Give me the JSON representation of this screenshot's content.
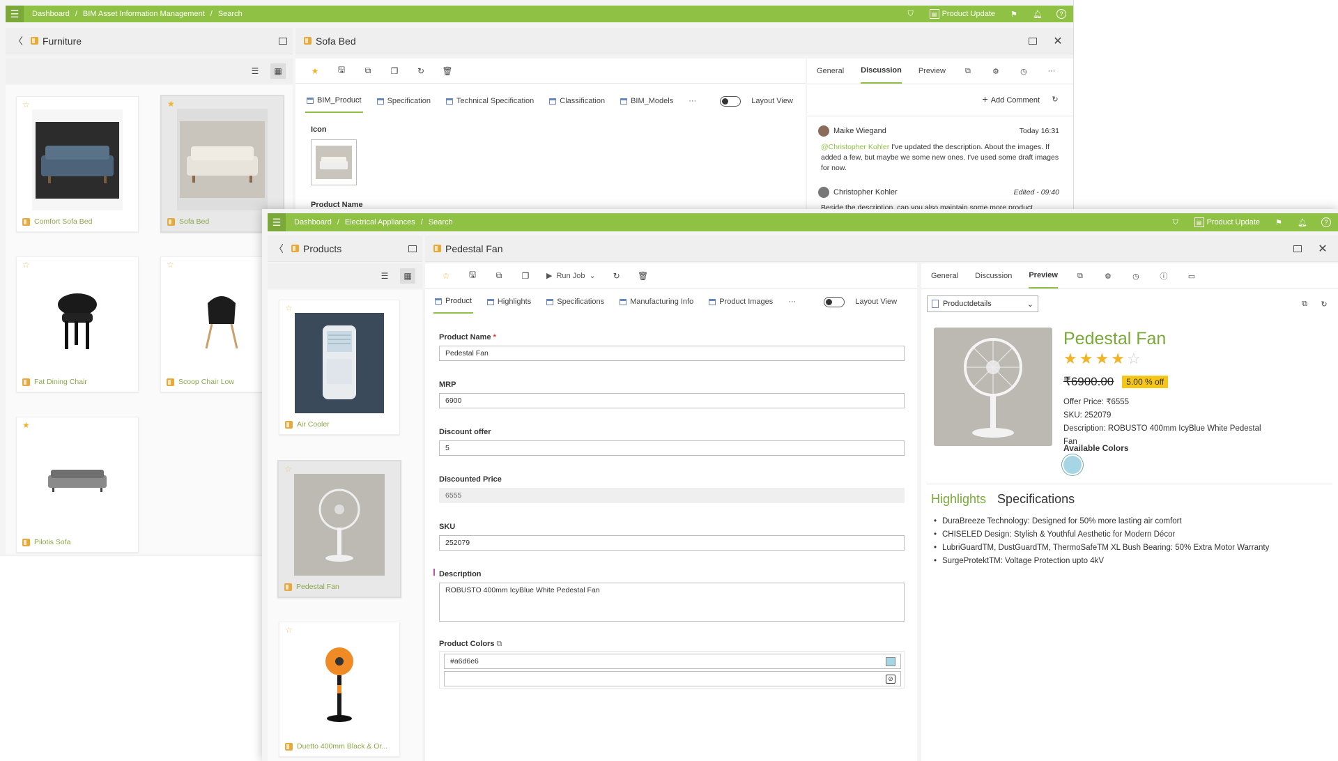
{
  "back_window": {
    "breadcrumb": [
      "Dashboard",
      "BIM Asset Information Management",
      "Search"
    ],
    "product_update": "Product Update",
    "left_title": "Furniture",
    "cards": [
      {
        "label": "Comfort Sofa Bed",
        "starred": false,
        "selected": false
      },
      {
        "label": "Sofa Bed",
        "starred": true,
        "selected": true
      },
      {
        "label": "Fat Dining Chair",
        "starred": false,
        "selected": false
      },
      {
        "label": "Scoop Chair Low",
        "starred": false,
        "selected": false
      },
      {
        "label": "Pilotis Sofa",
        "starred": true,
        "selected": false
      }
    ],
    "detail_title": "Sofa Bed",
    "tabs": [
      "BIM_Product",
      "Specification",
      "Technical Specification",
      "Classification",
      "BIM_Models"
    ],
    "more": "···",
    "layout_view": "Layout View",
    "icon_label": "Icon",
    "product_name_label": "Product Name",
    "right_tabs": [
      "General",
      "Discussion",
      "Preview"
    ],
    "add_comment": "Add Comment",
    "comments": [
      {
        "author": "Maike Wiegand",
        "time": "Today 16:31",
        "mention": "@Christopher Kohler",
        "text": " I've updated the description. About the images. If added a few, but maybe we some new ones. I've used some draft images for now."
      },
      {
        "author": "Christopher Kohler",
        "time": "Edited - 09:40",
        "text": "Beside the description, can you also maintain some more product"
      }
    ]
  },
  "front_window": {
    "breadcrumb": [
      "Dashboard",
      "Electrical Appliances",
      "Search"
    ],
    "product_update": "Product Update",
    "left_title": "Products",
    "cards": [
      {
        "label": "Air Cooler",
        "starred": false,
        "selected": false
      },
      {
        "label": "Pedestal Fan",
        "starred": false,
        "selected": true
      },
      {
        "label": "Duetto 400mm Black & Or...",
        "starred": false,
        "selected": false
      }
    ],
    "detail_title": "Pedestal Fan",
    "run_job": "Run Job",
    "tabs": [
      "Product",
      "Highlights",
      "Specifications",
      "Manufacturing Info",
      "Product Images"
    ],
    "more": "···",
    "layout_view": "Layout View",
    "fields": {
      "product_name_label": "Product Name",
      "required": "*",
      "product_name": "Pedestal Fan",
      "mrp_label": "MRP",
      "mrp": "6900",
      "discount_label": "Discount offer",
      "discount": "5",
      "discounted_price_label": "Discounted Price",
      "discounted_price": "6555",
      "sku_label": "SKU",
      "sku": "252079",
      "description_label": "Description",
      "description": "ROBUSTO 400mm IcyBlue White Pedestal Fan",
      "colors_label": "Product Colors",
      "color_value": "#a6d6e6"
    },
    "right_tabs": [
      "General",
      "Discussion",
      "Preview"
    ],
    "preview_select": "Productdetails",
    "preview": {
      "title": "Pedestal Fan",
      "rating": 4,
      "rating_max": 5,
      "old_price": "₹6900.00",
      "off_badge": "5.00 % off",
      "offer_price": "Offer Price: ₹6555",
      "sku": "SKU: 252079",
      "description": "Description: ROBUSTO 400mm IcyBlue White Pedestal Fan",
      "colors_heading": "Available Colors",
      "swatch": "#a6d6e6",
      "tab_highlights": "Highlights",
      "tab_specs": "Specifications",
      "highlights": [
        "DuraBreeze Technology: Designed for 50% more lasting air comfort",
        "CHISELED Design: Stylish & Youthful Aesthetic for Modern Décor",
        "LubriGuardTM, DustGuardTM, ThermoSafeTM XL Bush Bearing: 50% Extra Motor Warranty",
        "SurgeProtektTM: Voltage Protection upto 4kV"
      ]
    }
  },
  "colors": {
    "accent": "#8fc144",
    "star": "#f0b429",
    "badge": "#f5c518",
    "label_green": "#8aa74a"
  }
}
